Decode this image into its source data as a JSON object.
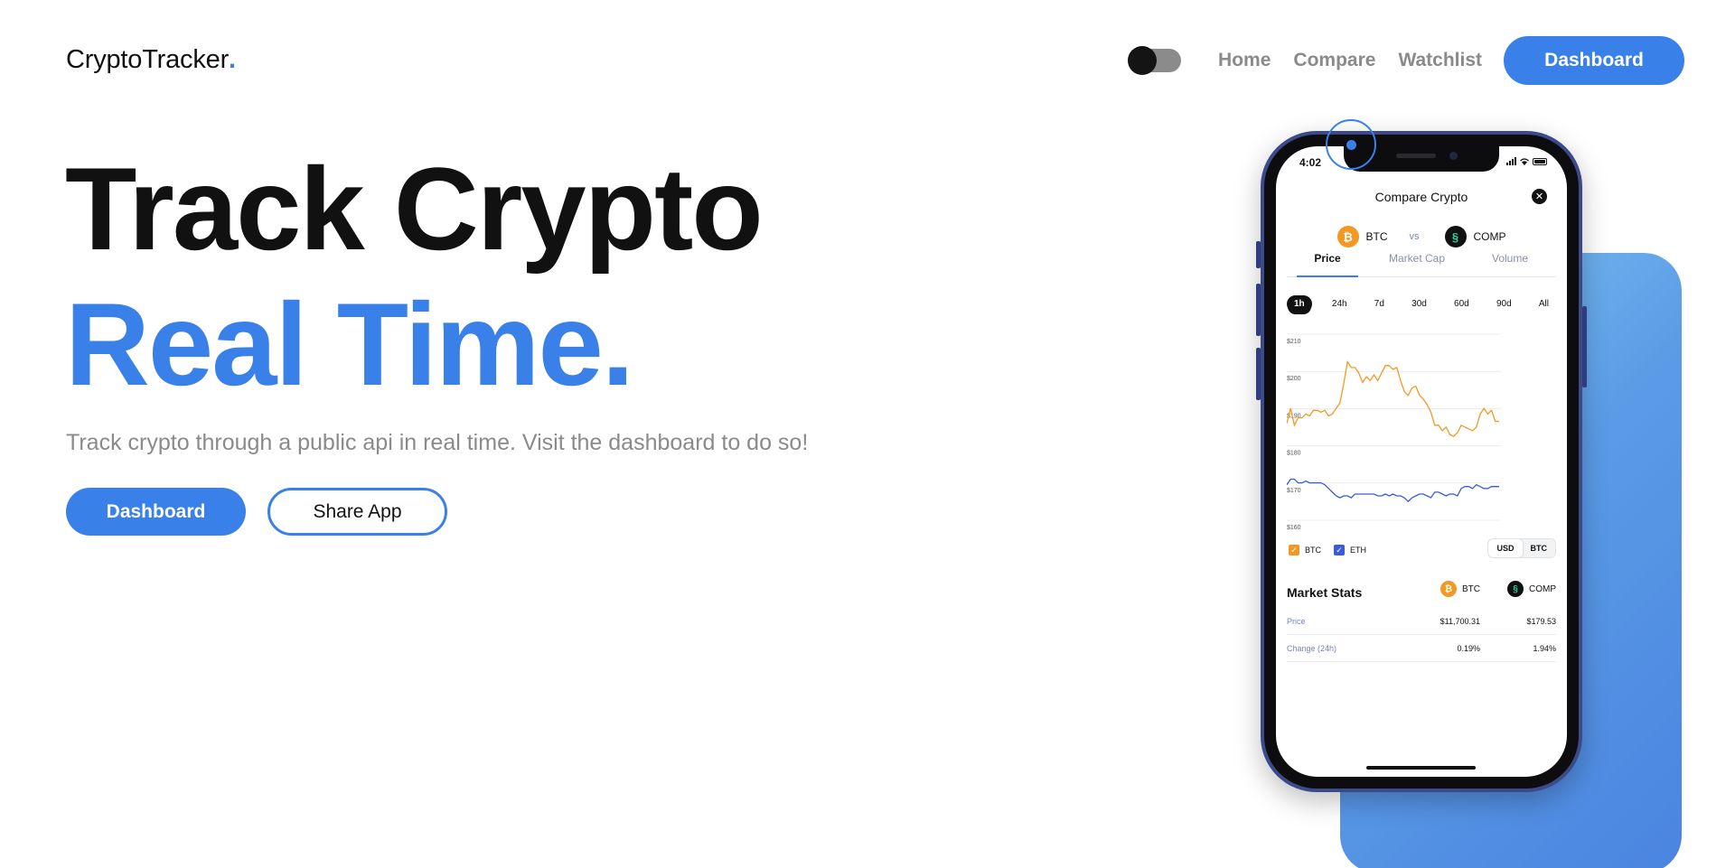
{
  "brand": {
    "name": "CryptoTracker",
    "dot": "."
  },
  "nav": {
    "links": [
      "Home",
      "Compare",
      "Watchlist"
    ],
    "cta": "Dashboard",
    "theme_toggle": "dark"
  },
  "hero": {
    "title_line1": "Track Crypto",
    "title_line2": "Real Time.",
    "subtitle": "Track crypto through a public api in real time. Visit the dashboard to do so!",
    "primary_button": "Dashboard",
    "secondary_button": "Share App"
  },
  "colors": {
    "accent": "#3a80e9",
    "btc_series": "#f29824",
    "eth_series": "#3a5bd9"
  },
  "phone": {
    "status_time": "4:02",
    "screen_title": "Compare Crypto",
    "close_icon": "close-icon",
    "pair": {
      "left": "BTC",
      "vs": "vs",
      "right": "COMP"
    },
    "tabs": [
      "Price",
      "Market Cap",
      "Volume"
    ],
    "active_tab": "Price",
    "ranges": [
      "1h",
      "24h",
      "7d",
      "30d",
      "60d",
      "90d",
      "All"
    ],
    "active_range": "1h",
    "legend": [
      {
        "label": "BTC",
        "checked": true
      },
      {
        "label": "ETH",
        "checked": true
      }
    ],
    "currency": [
      "USD",
      "BTC"
    ],
    "selected_currency": "USD",
    "market_stats": {
      "title": "Market Stats",
      "coins": [
        "BTC",
        "COMP"
      ],
      "rows": [
        {
          "label": "Price",
          "btc": "$11,700.31",
          "comp": "$179.53"
        },
        {
          "label": "Change (24h)",
          "btc": "0.19%",
          "comp": "1.94%"
        }
      ]
    }
  },
  "chart_data": {
    "type": "line",
    "title": "",
    "xlabel": "",
    "ylabel": "",
    "y_ticks": [
      "$210",
      "$200",
      "$190",
      "$180",
      "$170",
      "$160"
    ],
    "ylim": [
      160,
      210
    ],
    "grid": true,
    "series": [
      {
        "name": "BTC",
        "color": "#f29824",
        "values": [
          187.5,
          191.5,
          187,
          189,
          189,
          190,
          189.5,
          191,
          191,
          190.5,
          191,
          189.5,
          190,
          191.5,
          193,
          198,
          204,
          202.5,
          202.5,
          201,
          198.5,
          200,
          199,
          200.5,
          199,
          201,
          203,
          203,
          202,
          202.5,
          199,
          196,
          195,
          197,
          197.5,
          195,
          194,
          192.5,
          190.5,
          187,
          187,
          185.5,
          186.5,
          184.5,
          184,
          185,
          187,
          186.5,
          186,
          185.5,
          186.5,
          190,
          191.5,
          190,
          191,
          188,
          188
        ]
      },
      {
        "name": "ETH",
        "color": "#3a5bd9",
        "values": [
          171,
          172.5,
          172.5,
          171.5,
          171.5,
          172,
          171.5,
          171.5,
          171.5,
          171.5,
          171,
          170,
          169,
          168,
          167.5,
          168,
          168,
          167.5,
          168.5,
          168.5,
          168.5,
          168.5,
          168.5,
          168.5,
          168,
          168,
          168.5,
          168,
          168.5,
          168,
          168,
          167.5,
          166.5,
          167.5,
          168,
          168.5,
          168.5,
          168,
          167.5,
          169,
          169,
          168.5,
          168,
          168.5,
          168.5,
          168,
          170,
          170.5,
          170.5,
          170,
          171,
          170.5,
          170,
          170,
          170.5,
          170.5,
          170.5
        ]
      }
    ]
  }
}
